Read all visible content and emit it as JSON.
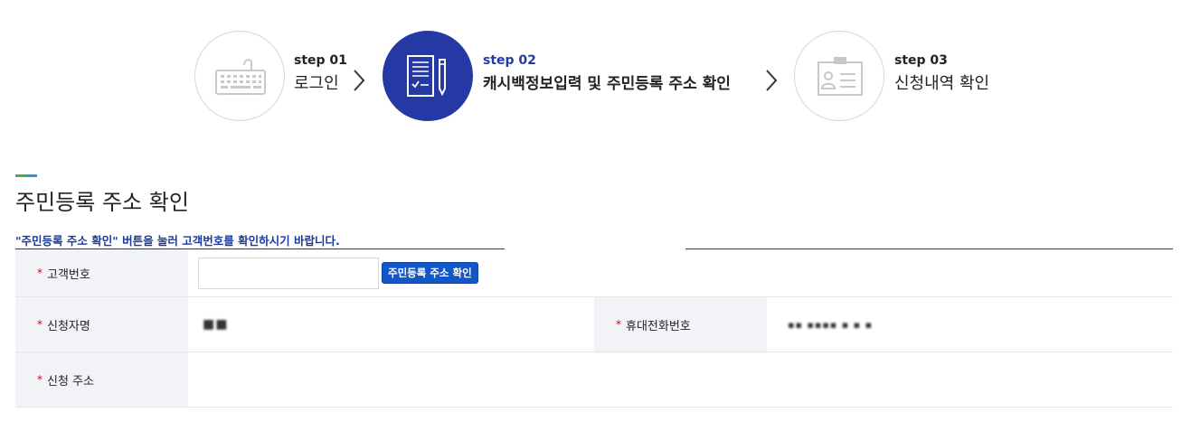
{
  "steps": [
    {
      "num": "step 01",
      "label": "로그인",
      "icon": "keyboard-icon",
      "state": "done"
    },
    {
      "num": "step 02",
      "label": "캐시백정보입력 및 주민등록 주소 확인",
      "icon": "document-pen-icon",
      "state": "active"
    },
    {
      "num": "step 03",
      "label": "신청내역 확인",
      "icon": "id-card-icon",
      "state": "pending"
    }
  ],
  "colors": {
    "active_step": "#2539a4",
    "guide_text": "#1a3a9c",
    "button": "#1257c7",
    "required_mark": "#d0021b",
    "title_bar_green": "#3db34a",
    "title_bar_blue": "#1f9bd7"
  },
  "section": {
    "title": "주민등록 주소 확인",
    "guide": "\"주민등록 주소 확인\" 버튼을 눌러 고객번호를 확인하시기 바랍니다."
  },
  "form": {
    "required_mark": "*",
    "customer_no": {
      "label": "고객번호",
      "value": "",
      "placeholder": ""
    },
    "confirm_button": "주민등록 주소 확인",
    "applicant": {
      "label": "신청자명",
      "value": "■■"
    },
    "mobile": {
      "label": "휴대전화번호",
      "value": "▪▪ ▪▪▪▪ ▪ ▪ ▪"
    },
    "address": {
      "label": "신청 주소",
      "value": ""
    }
  }
}
